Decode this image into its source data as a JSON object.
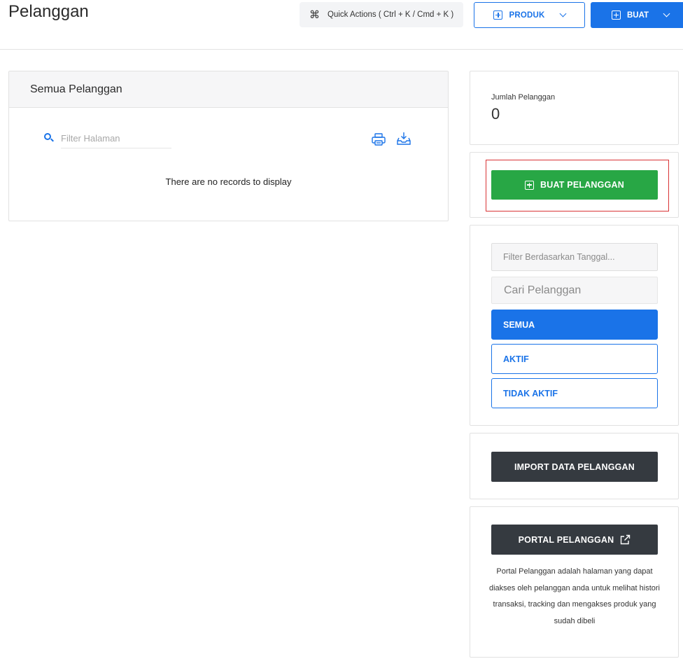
{
  "header": {
    "title": "Pelanggan",
    "quick_actions_label": "Quick Actions ( Ctrl + K / Cmd + K )",
    "produk_label": "PRODUK",
    "buat_label": "BUAT"
  },
  "customers_card": {
    "title": "Semua Pelanggan",
    "filter_placeholder": "Filter Halaman",
    "empty_message": "There are no records to display"
  },
  "summary": {
    "count_label": "Jumlah Pelanggan",
    "count_value": "0"
  },
  "actions": {
    "create_label": "BUAT PELANGGAN",
    "date_filter_placeholder": "Filter Berdasarkan Tanggal...",
    "search_placeholder": "Cari Pelanggan",
    "status_tabs": [
      {
        "label": "SEMUA",
        "active": true
      },
      {
        "label": "AKTIF",
        "active": false
      },
      {
        "label": "TIDAK AKTIF",
        "active": false
      }
    ],
    "import_label": "IMPORT DATA PELANGGAN",
    "portal_label": "PORTAL PELANGGAN",
    "portal_description": "Portal Pelanggan adalah halaman yang dapat diakses oleh pelanggan anda untuk melihat histori transaksi, tracking dan mengakses produk yang sudah dibeli"
  },
  "colors": {
    "primary": "#1a73e8",
    "success": "#28a745",
    "dark": "#353a40",
    "highlight": "#d93436"
  },
  "icons": [
    "command-icon",
    "plus-square-icon",
    "chevron-down-icon",
    "search-icon",
    "printer-icon",
    "download-tray-icon",
    "external-link-icon"
  ]
}
